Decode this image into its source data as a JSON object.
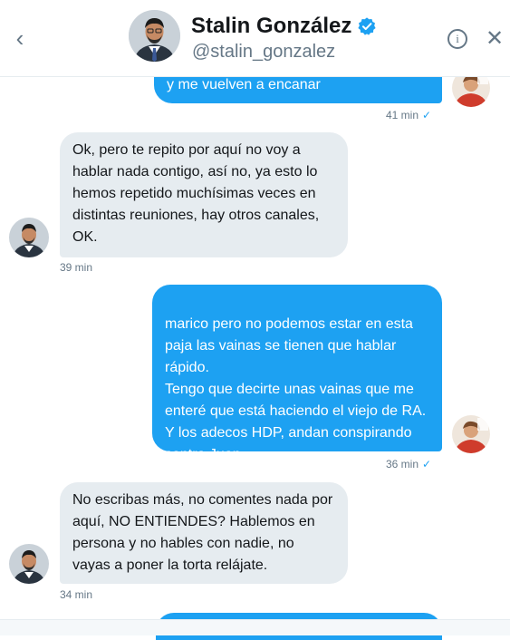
{
  "header": {
    "name": "Stalin González",
    "handle": "@stalin_gonzalez",
    "verified_icon": "verified-badge-icon",
    "back_icon": "chevron-left-icon",
    "info_icon": "info-icon",
    "close_icon": "close-icon"
  },
  "colors": {
    "accent": "#1da1f2",
    "incoming_bubble": "#e6ecf0",
    "muted_text": "#657786"
  },
  "messages": [
    {
      "direction": "outgoing",
      "text": "y me vuelven a encanar",
      "time": "41 min",
      "read": true
    },
    {
      "direction": "incoming",
      "text": "Ok, pero te repito por aquí no voy a hablar nada contigo, así no, ya esto lo hemos repetido muchísimas veces en distintas reuniones, hay otros canales, OK.",
      "time": "39 min"
    },
    {
      "direction": "outgoing",
      "text": "marico pero no podemos estar en esta paja las vainas se tienen que hablar rápido.\nTengo que decirte unas vainas que me enteré que está haciendo el viejo de RA. Y los adecos HDP, andan conspirando contra Juan",
      "time": "36 min",
      "read": true
    },
    {
      "direction": "incoming",
      "text": "No escribas más, no comentes nada por aquí, NO ENTIENDES? Hablemos en persona y no hables con nadie, no vayas a poner la torta relájate.",
      "time": "34 min"
    }
  ]
}
